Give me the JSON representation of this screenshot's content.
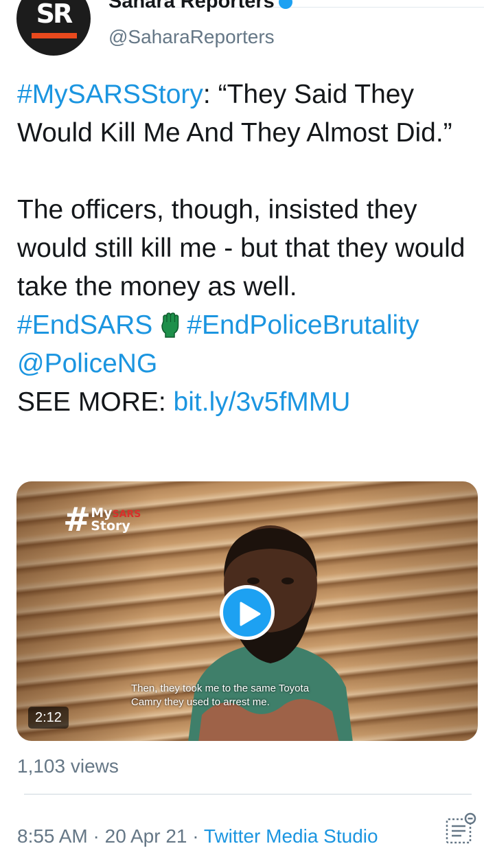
{
  "author": {
    "display_name": "Sahara Reporters",
    "handle": "@SaharaReporters",
    "avatar_text": "SR"
  },
  "tweet": {
    "hashtag_story": "#MySARSStory",
    "quote_rest": ": “They Said They Would Kill Me And They Almost Did.”",
    "body": "The officers, though, insisted they would still kill me - but that they would take the money as well.",
    "tag1": "#EndSARS",
    "tag2": "#EndPoliceBrutality",
    "mention": "@PoliceNG",
    "see_more_label": "SEE MORE: ",
    "link": "bit.ly/3v5fMMU"
  },
  "media": {
    "tagline_hash": "#",
    "tagline_my": "My",
    "tagline_sars": "SARS",
    "tagline_story": "Story",
    "subtitle_line1": "Then, they took me to the same Toyota",
    "subtitle_line2": "Camry they used to arrest me.",
    "duration": "2:12",
    "play_icon": "play-icon"
  },
  "stats": {
    "views": "1,103 views"
  },
  "meta": {
    "time": "8:55 AM",
    "separator": " · ",
    "date": "20 Apr 21",
    "source": "Twitter Media Studio"
  },
  "colors": {
    "link": "#1b95e0",
    "muted": "#657786",
    "text": "#14171a",
    "accent": "#1da1f2",
    "brand_orange": "#e8491d"
  }
}
